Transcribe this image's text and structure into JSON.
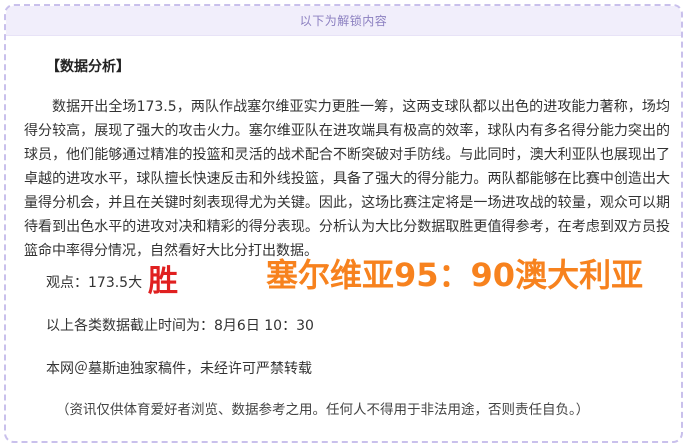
{
  "unlock_banner": "以下为解锁内容",
  "section_title": "【数据分析】",
  "analysis_paragraph": "数据开出全场173.5，两队作战塞尔维亚实力更胜一筹，这两支球队都以出色的进攻能力著称，场均得分较高，展现了强大的攻击火力。塞尔维亚队在进攻端具有极高的效率，球队内有多名得分能力突出的球员，他们能够通过精准的投篮和灵活的战术配合不断突破对手防线。与此同时，澳大利亚队也展现出了卓越的进攻水平，球队擅长快速反击和外线投篮，具备了强大的得分能力。两队都能够在比赛中创造出大量得分机会，并且在关键时刻表现得尤为关键。因此，这场比赛注定将是一场进攻战的较量，观众可以期待看到出色水平的进攻对决和精彩的得分表现。分析认为大比分数据取胜更值得参考，在考虑到双方员投篮命中率得分情况，自然看好大比分打出数据。",
  "opinion": {
    "label": "观点：173.5大",
    "win_mark": "胜",
    "score_prediction": "塞尔维亚95：90澳大利亚"
  },
  "deadline": "以上各类数据截止时间为：8月6日 10：30",
  "copyright": "本网＠墓斯迪独家稿件，未经许可严禁转载",
  "disclaimer": "（资讯仅供体育爱好者浏览、数据参考之用。任何人不得用于非法用途，否则责任自负。）",
  "colors": {
    "banner_bg": "#f1eefb",
    "banner_text": "#8b7fc0",
    "frame_border": "#c9c0ec",
    "win_mark": "#e02020",
    "score": "#f7821e"
  }
}
